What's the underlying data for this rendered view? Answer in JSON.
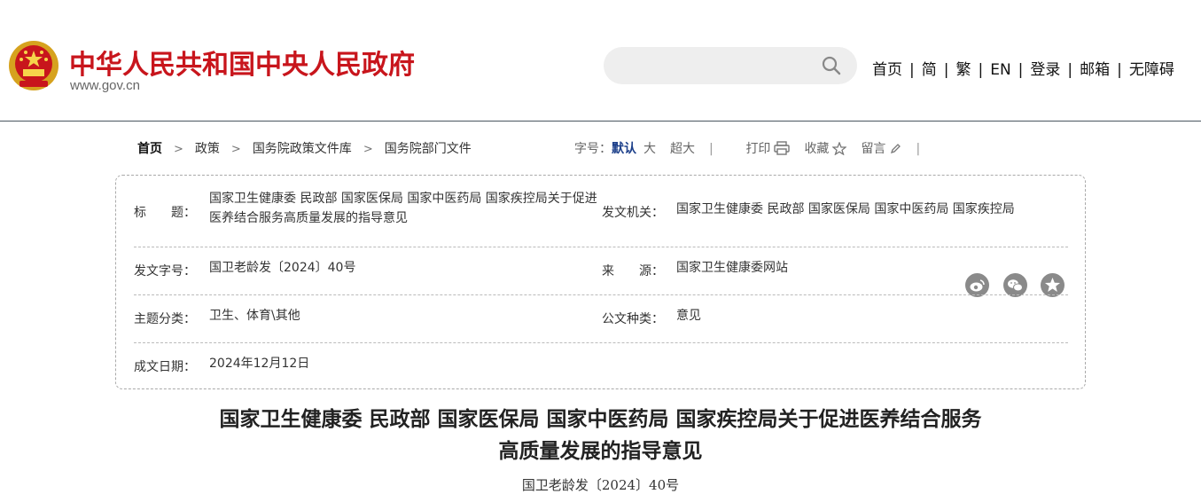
{
  "header": {
    "site_name": "中华人民共和国中央人民政府",
    "site_url": "www.gov.cn",
    "search_placeholder": "",
    "nav": [
      "首页",
      "简",
      "繁",
      "EN",
      "登录",
      "邮箱",
      "无障碍"
    ]
  },
  "breadcrumb": [
    "首页",
    "政策",
    "国务院政策文件库",
    "国务院部门文件"
  ],
  "tools": {
    "font_label": "字号：",
    "font_default": "默认",
    "font_large": "大",
    "font_xlarge": "超大",
    "print": "打印",
    "favorite": "收藏",
    "comment": "留言"
  },
  "share_icons": [
    "weibo-icon",
    "wechat-icon",
    "favorite-star-icon"
  ],
  "info": {
    "title_label": "标　　题：",
    "title_value": "国家卫生健康委 民政部 国家医保局 国家中医药局 国家疾控局关于促进医养结合服务高质量发展的指导意见",
    "issuer_label": "发文机关：",
    "issuer_value": "国家卫生健康委 民政部 国家医保局 国家中医药局 国家疾控局",
    "docno_label": "发文字号：",
    "docno_value": "国卫老龄发〔2024〕40号",
    "source_label": "来　　源：",
    "source_value": "国家卫生健康委网站",
    "topic_label": "主题分类：",
    "topic_value": "卫生、体育\\其他",
    "doctype_label": "公文种类：",
    "doctype_value": "意见",
    "date_label": "成文日期：",
    "date_value": "2024年12月12日"
  },
  "article": {
    "title_line1": "国家卫生健康委 民政部 国家医保局 国家中医药局 国家疾控局关于促进医养结合服务",
    "title_line2": "高质量发展的指导意见",
    "doc_number": "国卫老龄发〔2024〕40号"
  },
  "colors": {
    "brand_red": "#c8151c",
    "link_blue": "#1c3f8a",
    "icon_gray": "#8a8a8a"
  }
}
